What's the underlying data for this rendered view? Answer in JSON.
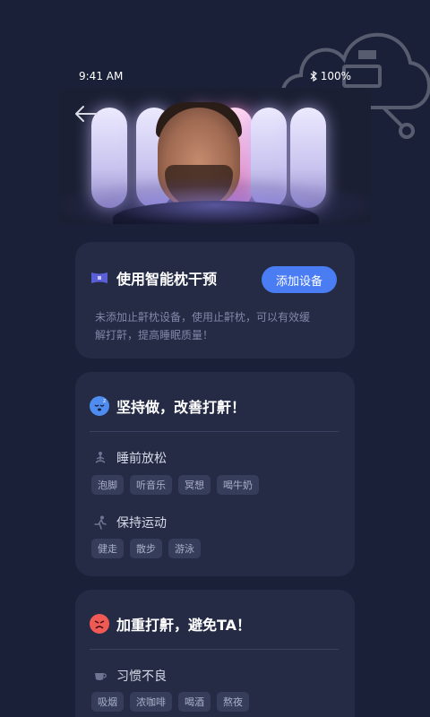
{
  "status": {
    "time": "9:41 AM",
    "battery": "100%"
  },
  "pillow_card": {
    "title": "使用智能枕干预",
    "add_button": "添加设备",
    "description": "未添加止鼾枕设备，使用止鼾枕，可以有效缓解打鼾，提高睡眠质量！"
  },
  "improve_card": {
    "title": "坚持做，改善打鼾！",
    "sections": [
      {
        "label": "睡前放松",
        "icon": "meditation-icon",
        "tags": [
          "泡脚",
          "听音乐",
          "冥想",
          "喝牛奶"
        ]
      },
      {
        "label": "保持运动",
        "icon": "running-icon",
        "tags": [
          "健走",
          "散步",
          "游泳"
        ]
      }
    ]
  },
  "avoid_card": {
    "title": "加重打鼾，避免TA！",
    "sections": [
      {
        "label": "习惯不良",
        "icon": "coffee-cup-icon",
        "tags": [
          "吸烟",
          "浓咖啡",
          "喝酒",
          "熬夜"
        ]
      }
    ]
  },
  "colors": {
    "background": "#1a2038",
    "card": "#252b44",
    "accent": "#4a7cf3",
    "tag_bg": "#363d5a"
  }
}
